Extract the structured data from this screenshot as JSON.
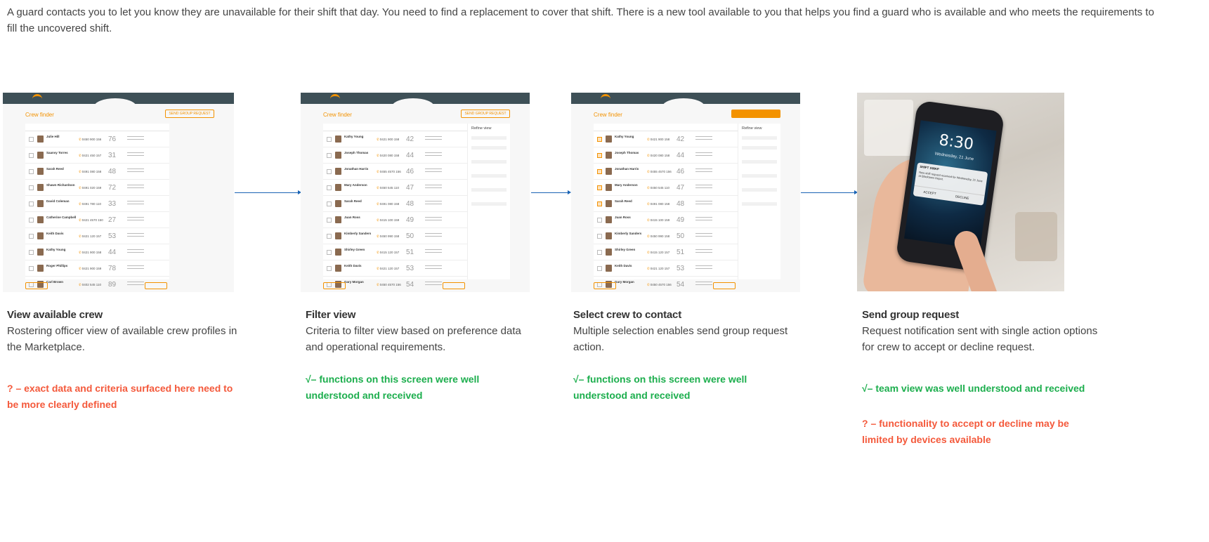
{
  "intro": "A guard contacts you to let you know they are unavailable for their shift that day. You need to find a replacement to cover that shift. There is a new tool available to you that helps you find a guard who is available and who meets the requirements to fill the uncovered shift.",
  "screens": {
    "app_title": "Crew finder",
    "send_button": "SEND GROUP REQUEST",
    "refine_title": "Refine view",
    "crew_list_1": [
      {
        "name": "Julie Hill",
        "phone": "0450 900 156",
        "fit": "76"
      },
      {
        "name": "Saanvy Torres",
        "phone": "0421 450 157",
        "fit": "31"
      },
      {
        "name": "Sarah Reed",
        "phone": "0491 080 158",
        "fit": "48"
      },
      {
        "name": "Shawn Richardson",
        "phone": "0491 020 159",
        "fit": "72"
      },
      {
        "name": "David Coleman",
        "phone": "0491 780 110",
        "fit": "33"
      },
      {
        "name": "Catherine Campbell",
        "phone": "0421 4570 150",
        "fit": "27"
      },
      {
        "name": "Keith Davis",
        "phone": "0421 120 157",
        "fit": "53"
      },
      {
        "name": "Kathy Young",
        "phone": "0421 900 158",
        "fit": "44"
      },
      {
        "name": "Roger Phillips",
        "phone": "0421 900 159",
        "fit": "78"
      },
      {
        "name": "Carl Brown",
        "phone": "0402 545 110",
        "fit": "89"
      }
    ],
    "crew_list_2": [
      {
        "name": "Kathy Young",
        "phone": "0421 900 158",
        "fit": "42"
      },
      {
        "name": "Joseph Thomas",
        "phone": "0420 080 158",
        "fit": "44"
      },
      {
        "name": "Jonathan Harris",
        "phone": "0455 4570 156",
        "fit": "46"
      },
      {
        "name": "Mary Anderson",
        "phone": "0450 545 110",
        "fit": "47"
      },
      {
        "name": "Sarah Reed",
        "phone": "0491 080 158",
        "fit": "48"
      },
      {
        "name": "Juan Ross",
        "phone": "0415 100 159",
        "fit": "49"
      },
      {
        "name": "Kimberly Sanders",
        "phone": "0450 990 158",
        "fit": "50"
      },
      {
        "name": "Shirley Green",
        "phone": "0415 120 157",
        "fit": "51"
      },
      {
        "name": "Keith Davis",
        "phone": "0421 120 157",
        "fit": "53"
      },
      {
        "name": "Gary Morgan",
        "phone": "0450 4570 156",
        "fit": "54"
      }
    ],
    "selected_rows": [
      true,
      true,
      true,
      true,
      true,
      false,
      false,
      false,
      false,
      false
    ]
  },
  "phone": {
    "time": "8:30",
    "date": "Wednesday, 21 June",
    "app": "SHIFT SWAP",
    "message": "New shift request received for Wednesday, 21 June at Blacktown Depot.",
    "accept": "ACCEPT",
    "decline": "DECLINE"
  },
  "captions": [
    {
      "title": "View available crew",
      "body": "Rostering officer view of available crew profiles in the Marketplace."
    },
    {
      "title": "Filter view",
      "body": "Criteria to filter view based on preference data and operational requirements."
    },
    {
      "title": "Select crew to contact",
      "body": "Multiple selection enables send group request action."
    },
    {
      "title": "Send group request",
      "body": "Request notification sent with single action options for crew to accept or decline request."
    }
  ],
  "notes": [
    {
      "text": "? – exact data and criteria surfaced here need to be more clearly defined",
      "color": "#f4593b"
    },
    {
      "text": "√– functions on this screen were well understood and received",
      "color": "#1cae4d"
    },
    {
      "text": "√– functions on this screen were well understood and received",
      "color": "#1cae4d"
    },
    {
      "text": "√– team view was well understood and received",
      "color": "#1cae4d"
    },
    {
      "text": "? – functionality to accept or decline may be limited by devices available",
      "color": "#f4593b"
    }
  ]
}
